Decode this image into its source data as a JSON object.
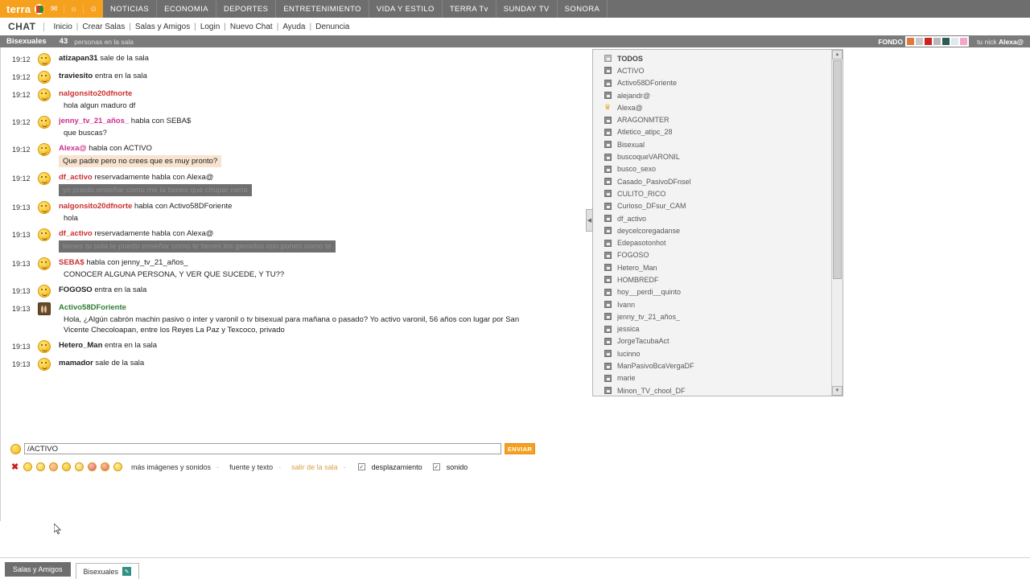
{
  "topnav": {
    "brand": "terra",
    "icons": [
      "mail-icon",
      "messenger-icon",
      "people-icon"
    ],
    "items": [
      "NOTICIAS",
      "ECONOMIA",
      "DEPORTES",
      "ENTRETENIMIENTO",
      "VIDA Y ESTILO",
      "TERRA Tv",
      "SUNDAY TV",
      "SONORA"
    ]
  },
  "chatnav": {
    "title": "CHAT",
    "links": [
      "Inicio",
      "Crear Salas",
      "Salas y Amigos",
      "Login",
      "Nuevo Chat",
      "Ayuda",
      "Denuncia"
    ]
  },
  "room": {
    "name": "Bisexuales",
    "count": "43",
    "count_text": "personas en la sala",
    "fondo_label": "FONDO",
    "fondo_swatches": [
      "#e07a3a",
      "#c9c9c9",
      "#cc2222",
      "#b8b8b8",
      "#2a5d56",
      "#e2e6ef",
      "#f4a6c8"
    ],
    "whoami_label": "tu nick",
    "whoami_value": "Alexa@"
  },
  "messages": [
    {
      "time": "19:12",
      "avatar": "smiley-face-icon",
      "nick": "atizapan31",
      "nick_color": "blk",
      "action": " sale de la sala",
      "text": "",
      "text_style": ""
    },
    {
      "time": "19:12",
      "avatar": "smiley-face-icon",
      "nick": "traviesito",
      "nick_color": "blk",
      "action": " entra en la sala",
      "text": "",
      "text_style": ""
    },
    {
      "time": "19:12",
      "avatar": "smiley-face-icon",
      "nick": "nalgonsito20dfnorte",
      "nick_color": "red",
      "action": "",
      "text": "hola algun maduro df",
      "text_style": ""
    },
    {
      "time": "19:12",
      "avatar": "smiley-face-icon",
      "nick": "jenny_tv_21_años_",
      "nick_color": "pink",
      "action": " habla con SEBA$",
      "text": "que buscas?",
      "text_style": ""
    },
    {
      "time": "19:12",
      "avatar": "wink-face-icon",
      "nick": "Alexa@",
      "nick_color": "pink",
      "action": " habla con ACTIVO",
      "text": "Que padre pero no crees que es muy pronto?",
      "text_style": "tan"
    },
    {
      "time": "19:12",
      "avatar": "smiley-face-icon",
      "nick": "df_activo",
      "nick_color": "red",
      "action": " reservadamente habla con Alexa@",
      "text": "yo puedo enseñar como me la tienes que chupar nena",
      "text_style": "sel"
    },
    {
      "time": "19:13",
      "avatar": "smiley-face-icon",
      "nick": "nalgonsito20dfnorte",
      "nick_color": "red",
      "action": " habla con Activo58DForiente",
      "text": "hola",
      "text_style": ""
    },
    {
      "time": "19:13",
      "avatar": "smiley-face-icon",
      "nick": "df_activo",
      "nick_color": "red",
      "action": " reservadamente habla con Alexa@",
      "text": "tienes tu sola te puedo enseñar como te tienes los gemidos con ponen como te",
      "text_style": "sel"
    },
    {
      "time": "19:13",
      "avatar": "smiley-face-icon",
      "nick": "SEBA$",
      "nick_color": "red",
      "action": " habla con jenny_tv_21_años_",
      "text": "CONOCER ALGUNA PERSONA, Y VER QUE SUCEDE, Y TU??",
      "text_style": ""
    },
    {
      "time": "19:13",
      "avatar": "smiley-face-icon",
      "nick": "FOGOSO",
      "nick_color": "blk",
      "action": " entra en la sala",
      "text": "",
      "text_style": ""
    },
    {
      "time": "19:13",
      "avatar": "male-avatar-icon",
      "nick": "Activo58DForiente",
      "nick_color": "green",
      "action": "",
      "text": "Hola, ¿Algún cabrón machin pasivo o inter y varonil o tv bisexual para mañana o pasado? Yo activo varonil, 56 años con lugar por San Vicente Checoloapan, entre los Reyes La Paz y Texcoco, privado",
      "text_style": "wide"
    },
    {
      "time": "19:13",
      "avatar": "smiley-face-icon",
      "nick": "Hetero_Man",
      "nick_color": "blk",
      "action": " entra en la sala",
      "text": "",
      "text_style": ""
    },
    {
      "time": "19:13",
      "avatar": "smiley-face-icon",
      "nick": "mamador",
      "nick_color": "blk",
      "action": " sale de la sala",
      "text": "",
      "text_style": ""
    }
  ],
  "userlist": [
    {
      "name": "TODOS",
      "icon": "group-icon"
    },
    {
      "name": "ACTIVO",
      "icon": "user-icon"
    },
    {
      "name": "Activo58DForiente",
      "icon": "user-icon"
    },
    {
      "name": "alejandr@",
      "icon": "user-icon"
    },
    {
      "name": "Alexa@",
      "icon": "crown-icon"
    },
    {
      "name": "ARAGONMTER",
      "icon": "user-icon"
    },
    {
      "name": "Atletico_atipc_28",
      "icon": "user-icon"
    },
    {
      "name": "Bisexual",
      "icon": "user-icon"
    },
    {
      "name": "buscoqueVARONIL",
      "icon": "user-icon"
    },
    {
      "name": "busco_sexo",
      "icon": "user-icon"
    },
    {
      "name": "Casado_PasivoDFnsel",
      "icon": "user-icon"
    },
    {
      "name": "CULITO_RICO",
      "icon": "user-icon"
    },
    {
      "name": "Curioso_DFsur_CAM",
      "icon": "user-icon"
    },
    {
      "name": "df_activo",
      "icon": "user-icon"
    },
    {
      "name": "deycelcoregadanse",
      "icon": "user-icon"
    },
    {
      "name": "Edepasotonhot",
      "icon": "user-icon"
    },
    {
      "name": "FOGOSO",
      "icon": "user-icon"
    },
    {
      "name": "Hetero_Man",
      "icon": "user-icon"
    },
    {
      "name": "HOMBREDF",
      "icon": "user-icon"
    },
    {
      "name": "hoy__perdi__quinto",
      "icon": "user-icon"
    },
    {
      "name": "Ivann",
      "icon": "user-icon"
    },
    {
      "name": "jenny_tv_21_años_",
      "icon": "user-icon"
    },
    {
      "name": "jessica",
      "icon": "user-icon"
    },
    {
      "name": "JorgeTacubaAct",
      "icon": "user-icon"
    },
    {
      "name": "lucinno",
      "icon": "user-icon"
    },
    {
      "name": "ManPasivoBcaVergaDF",
      "icon": "user-icon"
    },
    {
      "name": "marie",
      "icon": "user-icon"
    },
    {
      "name": "Minon_TV_chool_DF",
      "icon": "user-icon"
    }
  ],
  "composer": {
    "input_value": "/ACTIVO",
    "input_placeholder": "",
    "send_label": "ENVIAR",
    "emoticon_count": 9,
    "links": [
      "más imágenes y sonidos",
      "fuente y texto",
      "salir de la sala"
    ],
    "checkboxes": [
      {
        "label": "desplazamiento",
        "checked": true
      },
      {
        "label": "sonido",
        "checked": true
      }
    ]
  },
  "taskbar": {
    "button": "Salas y Amigos",
    "tab": "Bisexuales",
    "tab_icon": "pencil-icon"
  }
}
